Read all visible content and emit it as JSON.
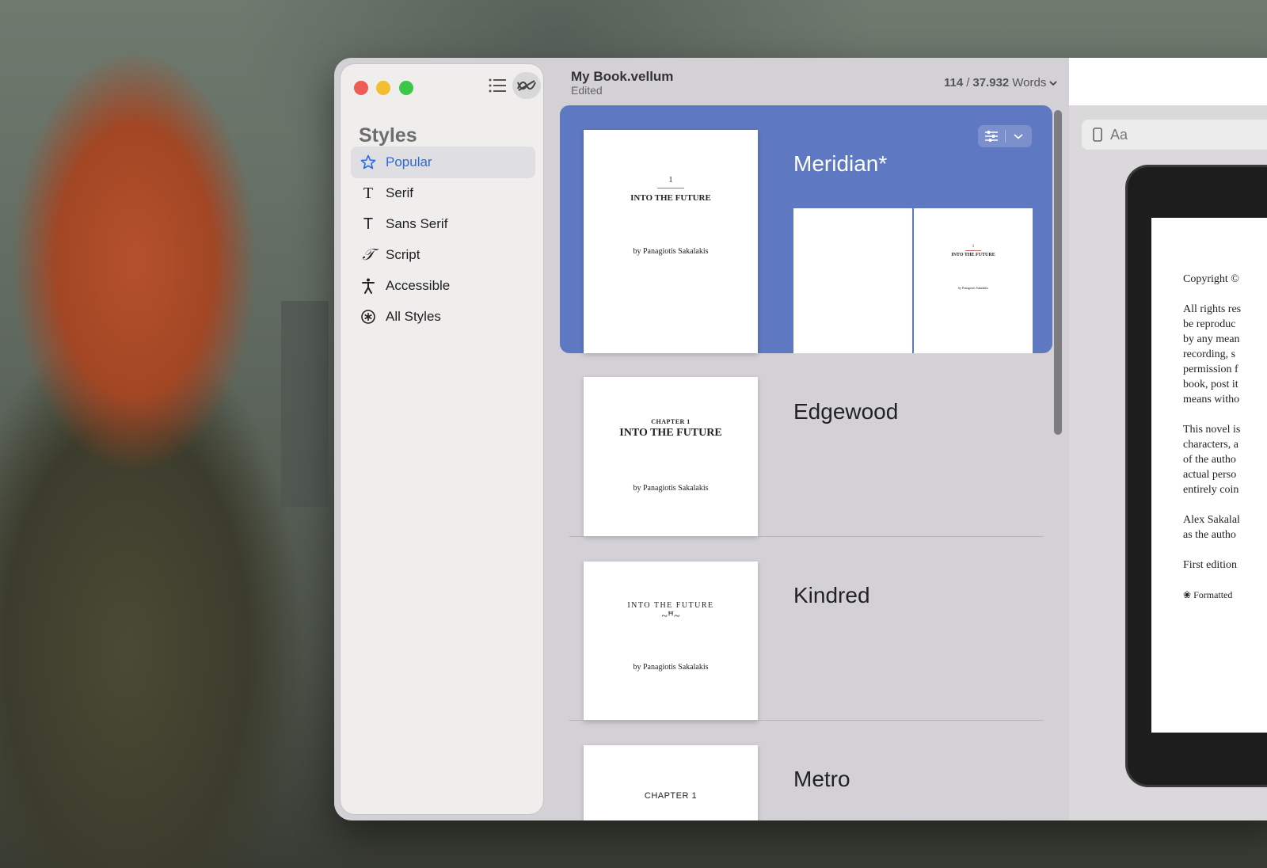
{
  "window": {
    "doc_title": "My Book.vellum",
    "doc_status": "Edited",
    "word_count_current": "114",
    "word_count_total": "37.932",
    "word_count_unit": "Words"
  },
  "sidebar": {
    "heading": "Styles",
    "items": [
      {
        "label": "Popular",
        "icon": "star-icon"
      },
      {
        "label": "Serif",
        "icon": "serif-t-icon"
      },
      {
        "label": "Sans Serif",
        "icon": "sans-t-icon"
      },
      {
        "label": "Script",
        "icon": "script-t-icon"
      },
      {
        "label": "Accessible",
        "icon": "accessibility-icon"
      },
      {
        "label": "All Styles",
        "icon": "asterisk-circle-icon"
      }
    ]
  },
  "styles_list": [
    {
      "name": "Meridian*",
      "thumb": {
        "chapter": "1",
        "title": "INTO THE FUTURE",
        "author": "by Panagiotis Sakalakis"
      },
      "spread": {
        "chapter": "1",
        "title": "INTO THE FUTURE",
        "author": "by Panagiotis Sakalakis"
      }
    },
    {
      "name": "Edgewood",
      "thumb": {
        "chapter": "CHAPTER 1",
        "title": "INTO THE FUTURE",
        "author": "by Panagiotis Sakalakis"
      }
    },
    {
      "name": "Kindred",
      "thumb": {
        "title": "INTO THE FUTURE",
        "ornament": "~ꟸ~",
        "author": "by Panagiotis Sakalakis"
      }
    },
    {
      "name": "Metro",
      "thumb": {
        "chapter": "CHAPTER 1"
      }
    }
  ],
  "preview": {
    "search_placeholder": "Aa",
    "page_lines": [
      "Copyright ©",
      "",
      "All rights res",
      "be reproduc",
      "by any mean",
      "recording, s",
      "permission f",
      "book, post it",
      "means witho",
      "",
      "This novel is",
      "characters, a",
      "of the autho",
      "actual perso",
      "entirely coin",
      "",
      "Alex Sakalal",
      "as the autho",
      "",
      "First edition",
      ""
    ],
    "formatted_note": "Formatted"
  },
  "colors": {
    "accent": "#2c6ad8",
    "selected_card": "#5f78c2",
    "close": "#ee5d55",
    "minimize": "#f2bd2f",
    "zoom": "#3dc748"
  }
}
